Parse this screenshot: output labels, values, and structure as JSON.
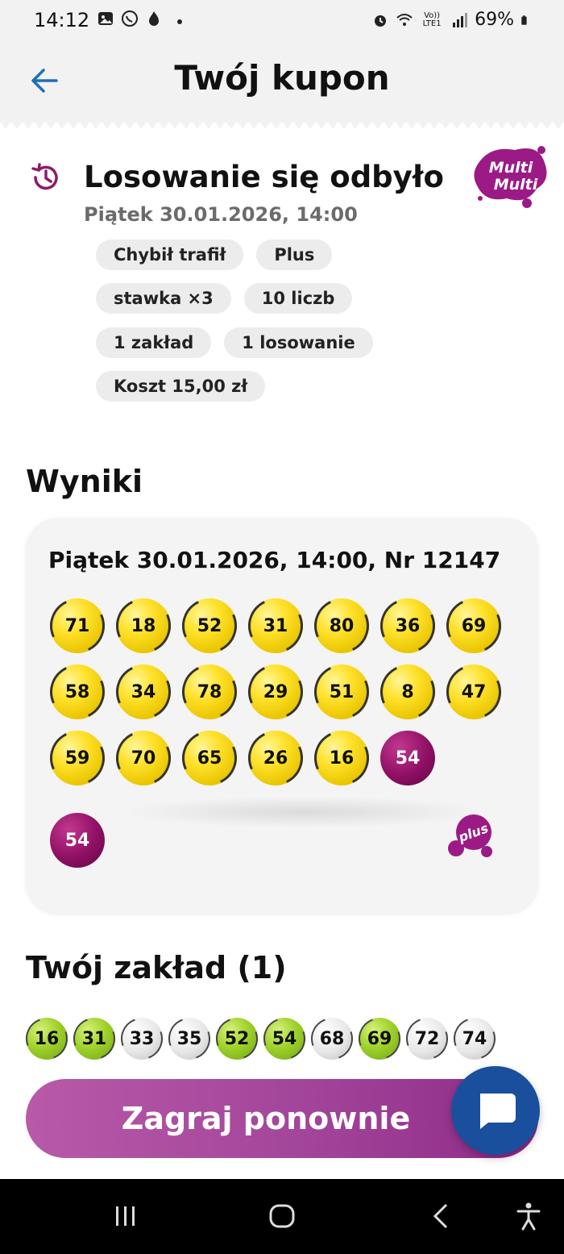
{
  "status_bar": {
    "time": "14:12",
    "battery": "69%",
    "network_small": "Vo)) LTE1"
  },
  "header": {
    "title": "Twój kupon"
  },
  "coupon": {
    "status": "Losowanie się odbyło",
    "date": "Piątek 30.01.2026, 14:00",
    "game_logo_text": [
      "Multi",
      "Multi"
    ],
    "chips": [
      [
        "Chybił trafił",
        "Plus"
      ],
      [
        "stawka ×3",
        "10 liczb"
      ],
      [
        "1 zakład",
        "1 losowanie"
      ],
      [
        "Koszt 15,00 zł"
      ]
    ]
  },
  "results": {
    "section_title": "Wyniki",
    "draw_header": "Piątek 30.01.2026, 14:00, Nr 12147",
    "numbers": [
      "71",
      "18",
      "52",
      "31",
      "80",
      "36",
      "69",
      "58",
      "34",
      "78",
      "29",
      "51",
      "8",
      "47",
      "59",
      "70",
      "65",
      "26",
      "16"
    ],
    "special_number": "54",
    "plus_number": "54",
    "plus_logo_text": "plus"
  },
  "bet": {
    "section_title": "Twój zakład (1)",
    "numbers": [
      {
        "n": "16",
        "hit": true
      },
      {
        "n": "31",
        "hit": true
      },
      {
        "n": "33",
        "hit": false
      },
      {
        "n": "35",
        "hit": false
      },
      {
        "n": "52",
        "hit": true
      },
      {
        "n": "54",
        "hit": true
      },
      {
        "n": "68",
        "hit": false
      },
      {
        "n": "69",
        "hit": true
      },
      {
        "n": "72",
        "hit": false
      },
      {
        "n": "74",
        "hit": false
      }
    ]
  },
  "actions": {
    "play_again": "Zagraj ponownie"
  },
  "colors": {
    "accent_purple": "#a2459a",
    "chat_blue": "#1a4f9e",
    "back_arrow": "#1f6fb5"
  }
}
